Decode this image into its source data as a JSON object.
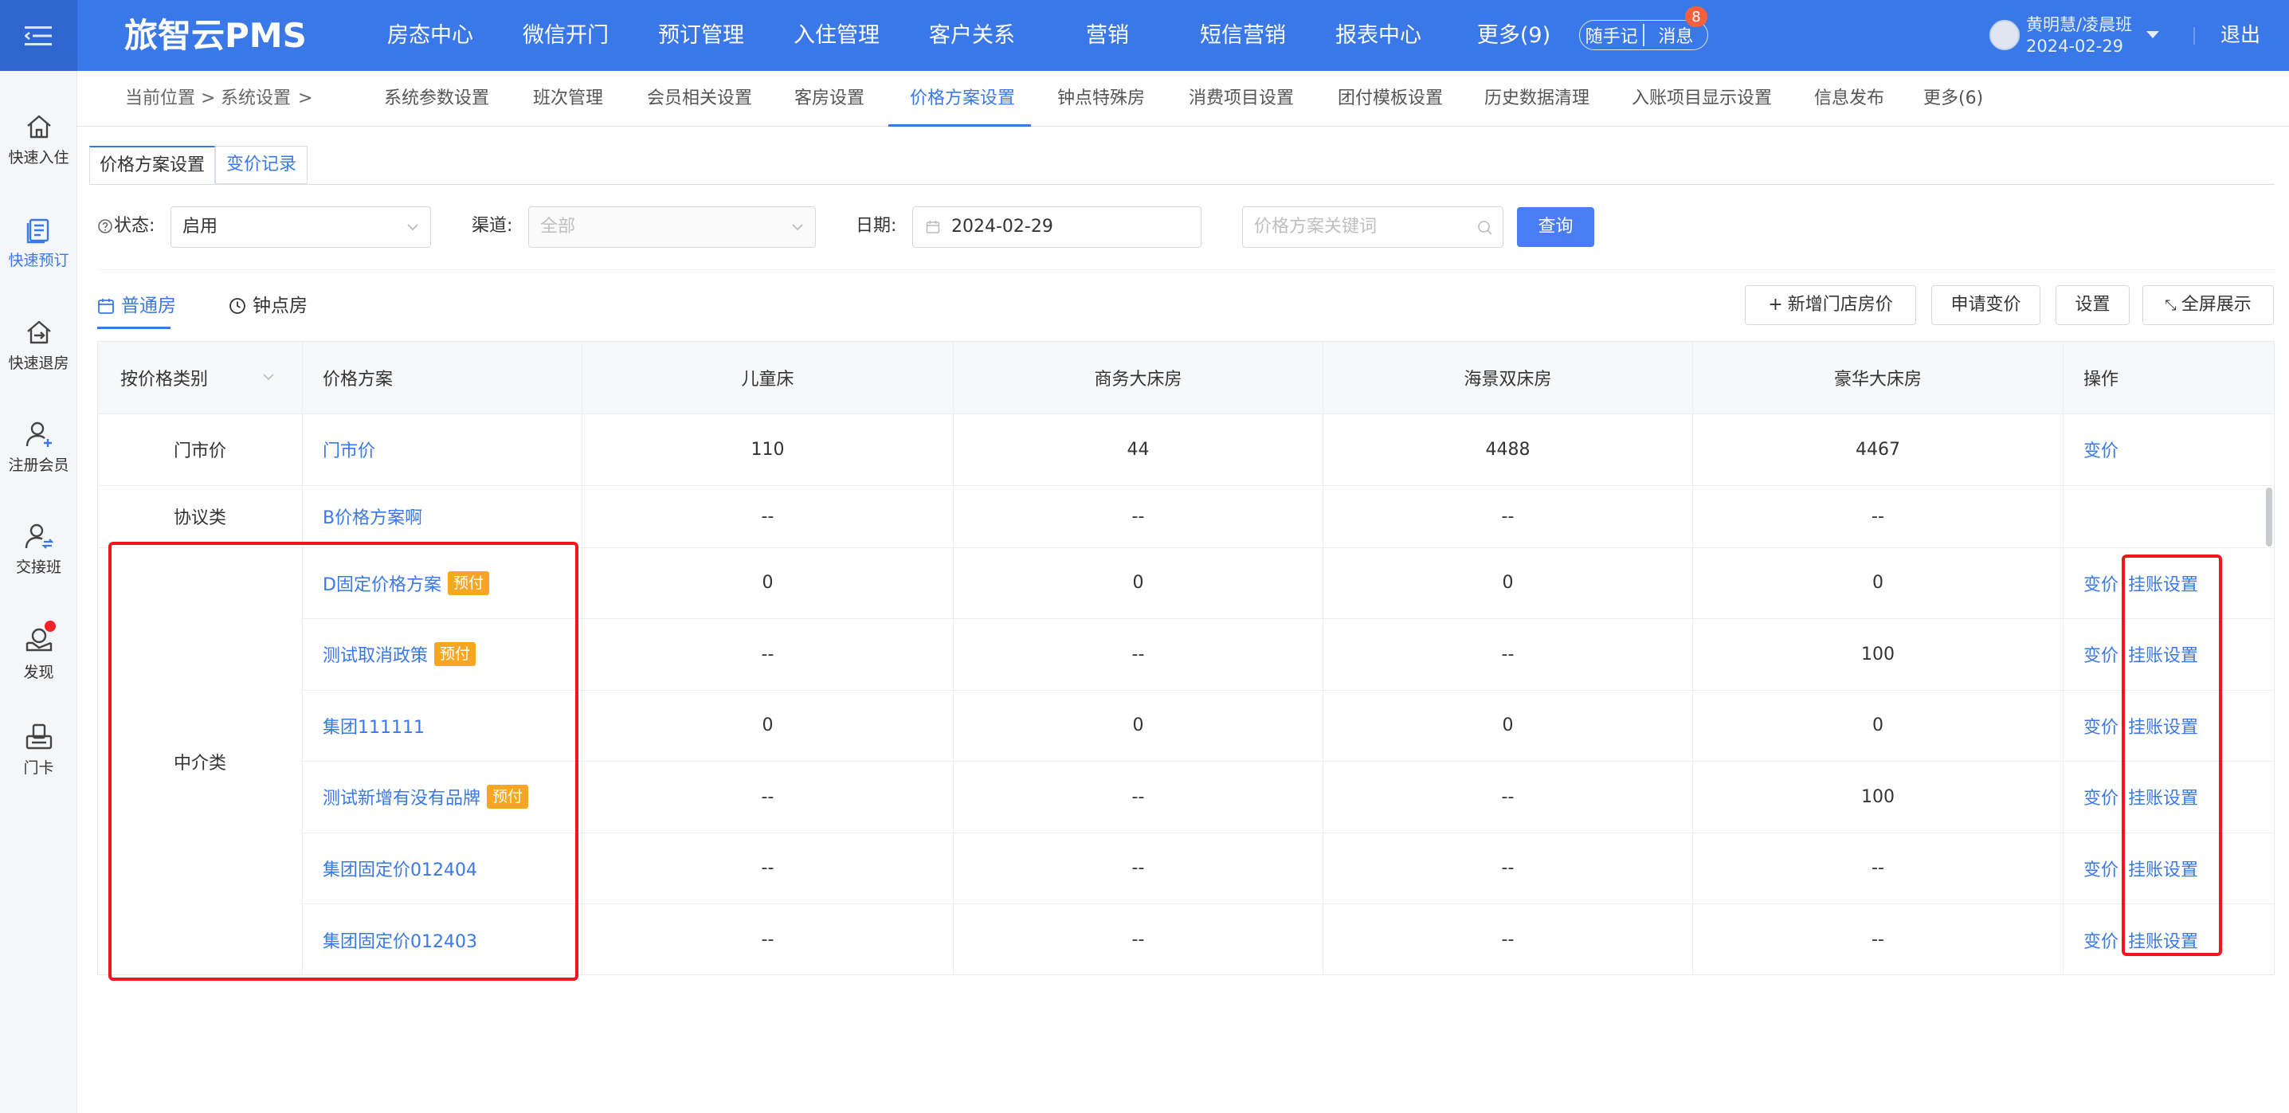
{
  "app": {
    "brand": "旅智云PMS"
  },
  "nav": [
    "房态中心",
    "微信开门",
    "预订管理",
    "入住管理",
    "客户关系",
    "营销",
    "短信营销",
    "报表中心",
    "更多(9)"
  ],
  "top_actions": {
    "notes": "随手记",
    "messages": "消息",
    "message_count": "8"
  },
  "user": {
    "name": "黄明慧/凌晨班",
    "date": "2024-02-29",
    "logout": "退出"
  },
  "rail": [
    "快速入住",
    "快速预订",
    "快速退房",
    "注册会员",
    "交接班",
    "发现",
    "门卡"
  ],
  "breadcrumb": {
    "label": "当前位置",
    "sep": ">",
    "item": "系统设置"
  },
  "subnav": [
    "系统参数设置",
    "班次管理",
    "会员相关设置",
    "客房设置",
    "价格方案设置",
    "钟点特殊房",
    "消费项目设置",
    "团付模板设置",
    "历史数据清理",
    "入账项目显示设置",
    "信息发布",
    "更多(6)"
  ],
  "tabs": [
    "价格方案设置",
    "变价记录"
  ],
  "filters": {
    "status_label": "状态:",
    "status_value": "启用",
    "channel_label": "渠道:",
    "channel_value": "全部",
    "date_label": "日期:",
    "date_value": "2024-02-29",
    "keyword_placeholder": "价格方案关键词",
    "query": "查询"
  },
  "room_tabs": [
    "普通房",
    "钟点房"
  ],
  "actions": [
    "新增门店房价",
    "申请变价",
    "设置",
    "全屏展示"
  ],
  "table": {
    "headers": [
      "按价格类别",
      "价格方案",
      "儿童床",
      "商务大床房",
      "海景双床房",
      "豪华大床房",
      "操作"
    ],
    "groups": [
      "门市价",
      "协议类",
      "中介类"
    ],
    "rows": [
      {
        "plan": "门市价",
        "tag": "",
        "values": [
          "110",
          "44",
          "4488",
          "4467"
        ],
        "op1": "变价",
        "op2": ""
      },
      {
        "plan": "B价格方案啊",
        "tag": "",
        "values": [
          "--",
          "--",
          "--",
          "--"
        ],
        "op1": "",
        "op2": ""
      },
      {
        "plan": "D固定价格方案",
        "tag": "预付",
        "values": [
          "0",
          "0",
          "0",
          "0"
        ],
        "op1": "变价",
        "op2": "挂账设置"
      },
      {
        "plan": "测试取消政策",
        "tag": "预付",
        "values": [
          "--",
          "--",
          "--",
          "100"
        ],
        "op1": "变价",
        "op2": "挂账设置"
      },
      {
        "plan": "集团111111",
        "tag": "",
        "values": [
          "0",
          "0",
          "0",
          "0"
        ],
        "op1": "变价",
        "op2": "挂账设置"
      },
      {
        "plan": "测试新增有没有品牌",
        "tag": "预付",
        "values": [
          "--",
          "--",
          "--",
          "100"
        ],
        "op1": "变价",
        "op2": "挂账设置"
      },
      {
        "plan": "集团固定价012404",
        "tag": "",
        "values": [
          "--",
          "--",
          "--",
          "--"
        ],
        "op1": "变价",
        "op2": "挂账设置"
      },
      {
        "plan": "集团固定价012403",
        "tag": "",
        "values": [
          "--",
          "--",
          "--",
          "--"
        ],
        "op1": "变价",
        "op2": "挂账设置"
      }
    ]
  },
  "colors": {
    "primary": "#3b78e7",
    "tag": "#f7a623",
    "highlight": "#f0161c"
  }
}
